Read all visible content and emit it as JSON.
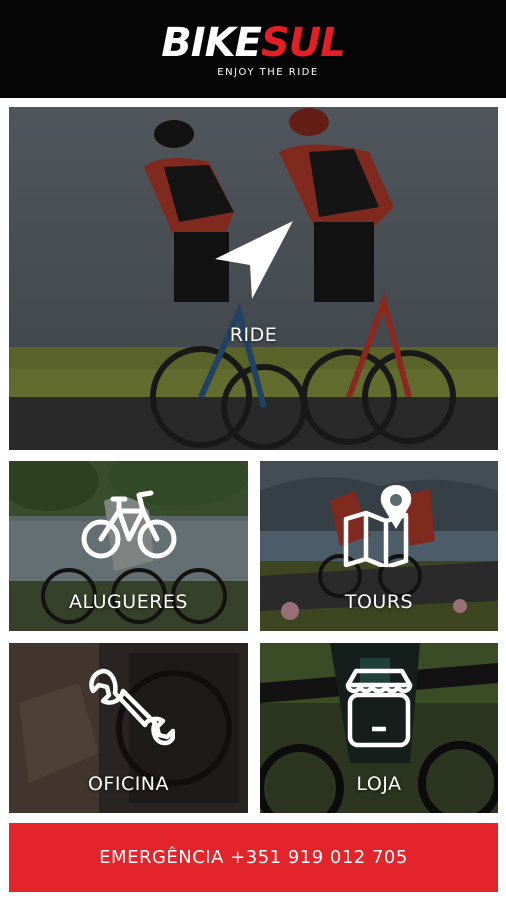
{
  "header": {
    "logo_white": "BIKE",
    "logo_red": "SUL",
    "tagline": "ENJOY THE RIDE"
  },
  "tiles": {
    "ride": {
      "label": "RIDE",
      "icon": "navigation-arrow-icon"
    },
    "alugueres": {
      "label": "ALUGUERES",
      "icon": "bicycle-icon"
    },
    "tours": {
      "label": "TOURS",
      "icon": "map-pin-icon"
    },
    "oficina": {
      "label": "OFICINA",
      "icon": "wrench-icon"
    },
    "loja": {
      "label": "LOJA",
      "icon": "shop-icon"
    }
  },
  "emergency": {
    "label": "EMERGÊNCIA +351 919 012 705"
  },
  "colors": {
    "brand_red": "#e31e24",
    "header_bg": "#050505",
    "emergency_bg": "#e3242b"
  }
}
